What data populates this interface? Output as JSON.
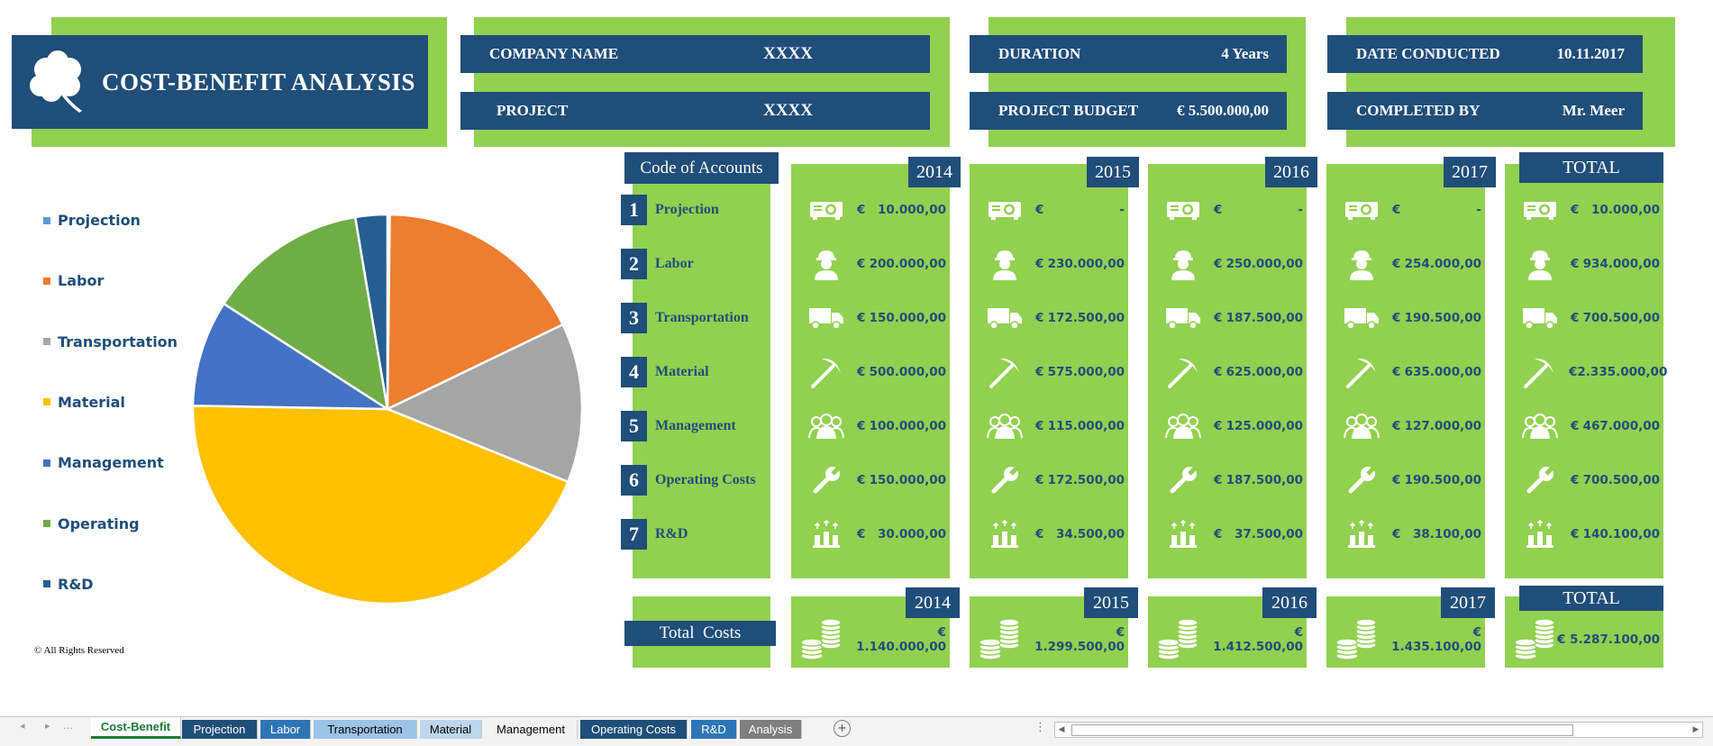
{
  "header": {
    "title": "COST-BENEFIT ANALYSIS",
    "company_label": "COMPANY NAME",
    "company_value": "XXXX",
    "project_label": "PROJECT",
    "project_value": "XXXX",
    "duration_label": "DURATION",
    "duration_value": "4 Years",
    "budget_label": "PROJECT BUDGET",
    "budget_value": "€ 5.500.000,00",
    "date_label": "DATE CONDUCTED",
    "date_value": "10.11.2017",
    "completed_label": "COMPLETED BY",
    "completed_value": "Mr. Meer"
  },
  "legend": [
    {
      "label": "Projection",
      "color": "#5b9bd5"
    },
    {
      "label": "Labor",
      "color": "#ed7d31"
    },
    {
      "label": "Transportation",
      "color": "#a5a5a5"
    },
    {
      "label": "Material",
      "color": "#ffc000"
    },
    {
      "label": "Management",
      "color": "#4472c4"
    },
    {
      "label": "Operating",
      "color": "#70ad47"
    },
    {
      "label": "R&D",
      "color": "#255e91"
    }
  ],
  "copyright": "© All Rights Reserved",
  "chart_data": {
    "type": "pie",
    "categories": [
      "Projection",
      "Labor",
      "Transportation",
      "Material",
      "Management",
      "Operating",
      "R&D"
    ],
    "values": [
      10000,
      934000,
      700500,
      2335000,
      467000,
      700500,
      140100
    ],
    "colors": [
      "#5b9bd5",
      "#ed7d31",
      "#a5a5a5",
      "#ffc000",
      "#4472c4",
      "#70ad47",
      "#255e91"
    ]
  },
  "codes": {
    "header": "Code of Accounts",
    "items": [
      {
        "num": "1",
        "label": "Projection",
        "icon": "projector-icon"
      },
      {
        "num": "2",
        "label": "Labor",
        "icon": "worker-icon"
      },
      {
        "num": "3",
        "label": "Transportation",
        "icon": "truck-icon"
      },
      {
        "num": "4",
        "label": "Material",
        "icon": "pickaxe-icon"
      },
      {
        "num": "5",
        "label": "Management",
        "icon": "team-icon"
      },
      {
        "num": "6",
        "label": "Operating Costs",
        "icon": "wrench-icon"
      },
      {
        "num": "7",
        "label": "R&D",
        "icon": "research-icon"
      }
    ]
  },
  "columns": [
    {
      "header": "2014",
      "currency": "€",
      "values": [
        "10.000,00",
        "200.000,00",
        "150.000,00",
        "500.000,00",
        "100.000,00",
        "150.000,00",
        "30.000,00"
      ],
      "total_header": "2014",
      "total": "€ 1.140.000,00"
    },
    {
      "header": "2015",
      "currency": "€",
      "values": [
        "-",
        "230.000,00",
        "172.500,00",
        "575.000,00",
        "115.000,00",
        "172.500,00",
        "34.500,00"
      ],
      "total_header": "2015",
      "total": "€ 1.299.500,00"
    },
    {
      "header": "2016",
      "currency": "€",
      "values": [
        "-",
        "250.000,00",
        "187.500,00",
        "625.000,00",
        "125.000,00",
        "187.500,00",
        "37.500,00"
      ],
      "total_header": "2016",
      "total": "€ 1.412.500,00"
    },
    {
      "header": "2017",
      "currency": "€",
      "values": [
        "-",
        "254.000,00",
        "190.500,00",
        "635.000,00",
        "127.000,00",
        "190.500,00",
        "38.100,00"
      ],
      "total_header": "2017",
      "total": "€ 1.435.100,00"
    },
    {
      "header": "TOTAL",
      "currency": "€",
      "values": [
        "10.000,00",
        "934.000,00",
        "700.500,00",
        "2.335.000,00",
        "467.000,00",
        "700.500,00",
        "140.100,00"
      ],
      "total_header": "TOTAL",
      "total": "€ 5.287.100,00"
    }
  ],
  "total_costs_label": "Total  Costs",
  "sheet_tabs": [
    {
      "label": "Cost-Benefit",
      "active": true,
      "bg": "#ffffff",
      "fg": "#1e7a34"
    },
    {
      "label": "Projection",
      "bg": "#1f4e79",
      "fg": "#ffffff"
    },
    {
      "label": "Labor",
      "bg": "#2e75b6",
      "fg": "#ffffff"
    },
    {
      "label": "Transportation",
      "bg": "#9dc3e6",
      "fg": "#000000"
    },
    {
      "label": "Material",
      "bg": "#bdd7ee",
      "fg": "#000000"
    },
    {
      "label": "Management",
      "bg": "#f2f2f2",
      "fg": "#000000"
    },
    {
      "label": "Operating Costs",
      "bg": "#1f4e79",
      "fg": "#ffffff"
    },
    {
      "label": "R&D",
      "bg": "#2e75b6",
      "fg": "#ffffff"
    },
    {
      "label": "Analysis",
      "bg": "#7f7f7f",
      "fg": "#ffffff"
    }
  ]
}
